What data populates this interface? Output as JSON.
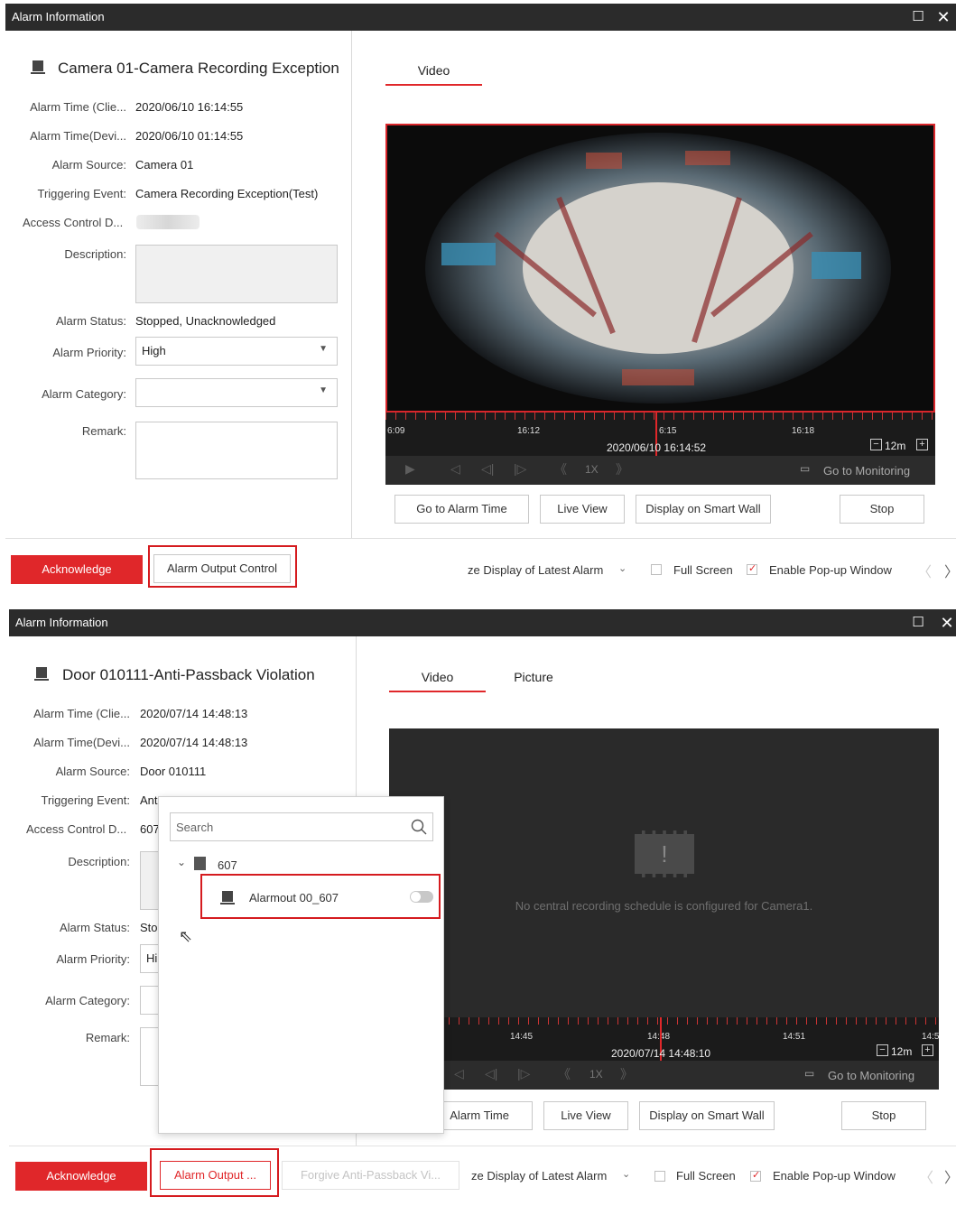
{
  "window1": {
    "title": "Alarm Information",
    "alarm_title": "Camera 01-Camera Recording Exception",
    "fields": {
      "alarm_time_client_label": "Alarm Time (Clie...",
      "alarm_time_client": "2020/06/10 16:14:55",
      "alarm_time_device_label": "Alarm Time(Devi...",
      "alarm_time_device": "2020/06/10 01:14:55",
      "alarm_source_label": "Alarm Source:",
      "alarm_source": "Camera 01",
      "triggering_event_label": "Triggering Event:",
      "triggering_event": "Camera Recording Exception(Test)",
      "access_control_label": "Access Control D...",
      "description_label": "Description:",
      "alarm_status_label": "Alarm Status:",
      "alarm_status": "Stopped, Unacknowledged",
      "alarm_priority_label": "Alarm Priority:",
      "alarm_priority": "High",
      "alarm_category_label": "Alarm Category:",
      "alarm_category": "",
      "remark_label": "Remark:"
    },
    "tabs": [
      "Video"
    ],
    "timeline": {
      "ticks": [
        "6:09",
        "16:12",
        "6:15",
        "16:18"
      ],
      "timestamp": "2020/06/10 16:14:52",
      "zoom": "12m"
    },
    "playback": {
      "speed": "1X",
      "go_to_monitoring": "Go to Monitoring"
    },
    "buttons": {
      "go_to_alarm_time": "Go to Alarm Time",
      "live_view": "Live View",
      "display_on_smart_wall": "Display on Smart Wall",
      "stop": "Stop",
      "acknowledge": "Acknowledge",
      "alarm_output_control": "Alarm Output Control"
    },
    "bottom": {
      "latest_alarm": "ze Display of Latest Alarm",
      "full_screen": "Full Screen",
      "enable_popup": "Enable Pop-up Window",
      "full_screen_checked": false,
      "enable_popup_checked": true
    }
  },
  "window2": {
    "title": "Alarm Information",
    "alarm_title": "Door 010111-Anti-Passback Violation",
    "fields": {
      "alarm_time_client_label": "Alarm Time (Clie...",
      "alarm_time_client": "2020/07/14 14:48:13",
      "alarm_time_device_label": "Alarm Time(Devi...",
      "alarm_time_device": "2020/07/14 14:48:13",
      "alarm_source_label": "Alarm Source:",
      "alarm_source": "Door 010111",
      "triggering_event_label": "Triggering Event:",
      "triggering_event_partial": "Ant",
      "access_control_label": "Access Control D...",
      "access_control_partial": "607",
      "description_label": "Description:",
      "alarm_status_label": "Alarm Status:",
      "alarm_status_partial": "Sto",
      "alarm_priority_label": "Alarm Priority:",
      "alarm_priority_partial": "Hi",
      "alarm_category_label": "Alarm Category:",
      "remark_label": "Remark:"
    },
    "tabs": [
      "Video",
      "Picture"
    ],
    "video_message": "No central recording schedule is configured for Camera1.",
    "timeline": {
      "ticks": [
        "14:45",
        "14:48",
        "14:51",
        "14:5"
      ],
      "timestamp": "2020/07/14 14:48:10",
      "zoom": "12m"
    },
    "playback": {
      "speed": "1X",
      "go_to_monitoring": "Go to Monitoring"
    },
    "buttons": {
      "go_to_alarm_time_partial": "Alarm Time",
      "live_view": "Live View",
      "display_on_smart_wall": "Display on Smart Wall",
      "stop": "Stop",
      "acknowledge": "Acknowledge",
      "alarm_output": "Alarm Output ...",
      "forgive_anti_passback": "Forgive Anti-Passback Vi..."
    },
    "popup": {
      "search_placeholder": "Search",
      "group": "607",
      "item": "Alarmout 00_607",
      "item_enabled": false
    },
    "bottom": {
      "latest_alarm": "ze Display of Latest Alarm",
      "full_screen": "Full Screen",
      "enable_popup": "Enable Pop-up Window",
      "full_screen_checked": false,
      "enable_popup_checked": true
    }
  }
}
